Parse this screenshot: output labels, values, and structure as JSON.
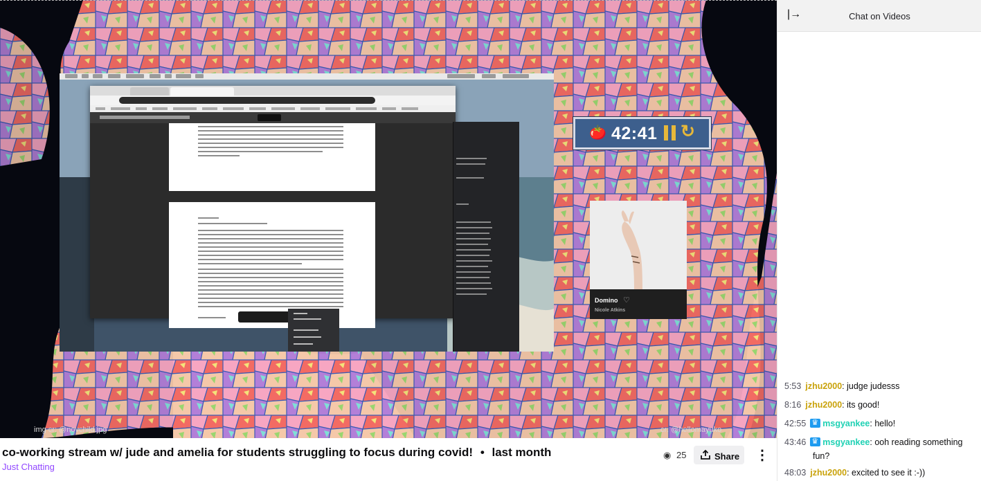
{
  "player": {
    "timer": {
      "time": "42:41",
      "tomato_icon": "🍅"
    },
    "now_playing": {
      "track": "Domino",
      "artist": "Nicole Atkins"
    },
    "credit_left": "img cr: @novchild.jpg",
    "credit_right": "cr: @hellomayuko"
  },
  "stream": {
    "title": "co-working stream w/ jude and amelia for students struggling to focus during covid!",
    "separator": "•",
    "age": "last month",
    "category": "Just Chatting",
    "viewer_count": "25",
    "share_label": "Share",
    "eye_icon": "◉",
    "more_icon": "⋮"
  },
  "chat": {
    "collapse_icon": "|→",
    "title": "Chat on Videos",
    "messages": [
      {
        "time": "5:53",
        "user": "jzhu2000",
        "color": "#c9a20a",
        "badge": false,
        "text": ": judge judesss"
      },
      {
        "time": "8:16",
        "user": "jzhu2000",
        "color": "#c9a20a",
        "badge": false,
        "text": ": its good!"
      },
      {
        "time": "42:55",
        "user": "msgyankee",
        "color": "#1fd1b4",
        "badge": true,
        "text": ": hello!"
      },
      {
        "time": "43:46",
        "user": "msgyankee",
        "color": "#1fd1b4",
        "badge": true,
        "text": ": ooh reading something",
        "cont": "fun?"
      },
      {
        "time": "48:03",
        "user": "jzhu2000",
        "color": "#c9a20a",
        "badge": false,
        "text": ": excited to see it :-))"
      }
    ]
  }
}
